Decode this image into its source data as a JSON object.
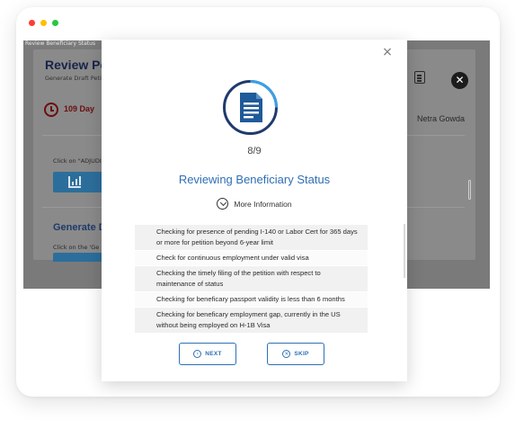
{
  "window": {
    "dot_colors": [
      "#ff3b30",
      "#ffbf00",
      "#28c840"
    ]
  },
  "background": {
    "breadcrumb": "Review Beneficiary Status",
    "title": "Review Peti",
    "subtitle": "Generate Draft Petit",
    "days_badge": "109 Day",
    "user_name": "Netra Gowda",
    "click_text_1": "Click on \"ADJUDI",
    "section_title": "Generate D",
    "click_text_2": "Click on the 'Ge",
    "close_glyph": "✕"
  },
  "modal": {
    "close_glyph": "×",
    "icon": "document-icon",
    "step": "8/9",
    "title": "Reviewing Beneficiary Status",
    "more_info_label": "More Information",
    "checks": [
      "Checking for presence of pending I-140 or Labor Cert for 365 days or more for petition beyond 6-year limit",
      "Check for continuous employment under valid visa",
      "Checking the timely filing of the petition with respect to maintenance of status",
      "Checking for beneficary passport validity is less than 6 months",
      "Checking for beneficary employment gap, currently in the US without being employed on H-1B Visa"
    ],
    "next_label": "NEXT",
    "skip_label": "SKIP",
    "accent_color": "#2e6fb5"
  }
}
